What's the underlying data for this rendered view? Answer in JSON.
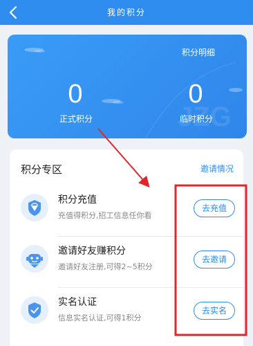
{
  "nav": {
    "title": "我的积分",
    "back_icon": "chevron-left-icon"
  },
  "summary": {
    "detail_link": "积分明细",
    "formal_points": "0",
    "formal_label": "正式积分",
    "temp_points": "0",
    "temp_label": "临时积分",
    "watermark": "JZG"
  },
  "zone": {
    "title": "积分专区",
    "invite_status_link": "邀请情况",
    "items": [
      {
        "icon": "diamond-shield-icon",
        "name": "积分充值",
        "desc": "充值得积分,招工信息任你看",
        "button": "去充值"
      },
      {
        "icon": "robot-face-icon",
        "name": "邀请好友赚积分",
        "desc": "邀请好友注册,可得2~5积分",
        "button": "去邀请"
      },
      {
        "icon": "verified-shield-icon",
        "name": "实名认证",
        "desc": "信息实名认证,可得1积分",
        "button": "去实名"
      }
    ]
  },
  "colors": {
    "primary": "#2f8df0",
    "annotation": "#e0262c"
  }
}
